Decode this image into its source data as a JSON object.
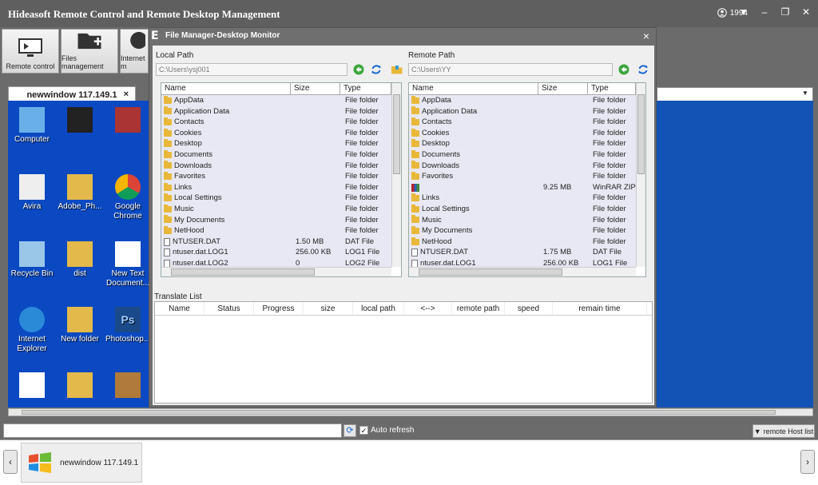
{
  "app": {
    "title": "Hideasoft Remote Control and Remote Desktop Management",
    "user": "1994"
  },
  "toolbar": {
    "remote_control": "Remote control",
    "files_management": "Files management",
    "internet": "Internet m"
  },
  "session_tab": {
    "label": "newwindow 117.149.1",
    "close": "×"
  },
  "desktop_icons": [
    {
      "label": "Computer",
      "icon": "computer-icon"
    },
    {
      "label": "",
      "icon": "qq-icon"
    },
    {
      "label": "",
      "icon": "winrar-icon"
    },
    {
      "label": "Avira",
      "icon": "shortcut-icon"
    },
    {
      "label": "Adobe_Ph...",
      "icon": "folder-icon"
    },
    {
      "label": "Google Chrome",
      "icon": "chrome-icon"
    },
    {
      "label": "Recycle Bin",
      "icon": "recycle-bin-icon"
    },
    {
      "label": "dist",
      "icon": "folder-icon"
    },
    {
      "label": "New Text Document...",
      "icon": "text-file-icon"
    },
    {
      "label": "Internet Explorer",
      "icon": "ie-icon"
    },
    {
      "label": "New folder",
      "icon": "folder-icon"
    },
    {
      "label": "Photoshop...",
      "icon": "photoshop-icon"
    },
    {
      "label": "",
      "icon": "app-icon"
    },
    {
      "label": "",
      "icon": "folder-icon"
    },
    {
      "label": "",
      "icon": "box-icon"
    }
  ],
  "dialog": {
    "title": "File Manager-Desktop Monitor",
    "close": "×",
    "local": {
      "label": "Local Path",
      "path": "C:\\Users\\ysj001",
      "columns": [
        "Name",
        "Size",
        "Type"
      ],
      "rows": [
        {
          "name": "AppData",
          "size": "",
          "type": "File folder",
          "kind": "folder"
        },
        {
          "name": "Application Data",
          "size": "",
          "type": "File folder",
          "kind": "folder"
        },
        {
          "name": "Contacts",
          "size": "",
          "type": "File folder",
          "kind": "folder"
        },
        {
          "name": "Cookies",
          "size": "",
          "type": "File folder",
          "kind": "folder"
        },
        {
          "name": "Desktop",
          "size": "",
          "type": "File folder",
          "kind": "folder"
        },
        {
          "name": "Documents",
          "size": "",
          "type": "File folder",
          "kind": "folder"
        },
        {
          "name": "Downloads",
          "size": "",
          "type": "File folder",
          "kind": "folder"
        },
        {
          "name": "Favorites",
          "size": "",
          "type": "File folder",
          "kind": "folder"
        },
        {
          "name": "Links",
          "size": "",
          "type": "File folder",
          "kind": "folder"
        },
        {
          "name": "Local Settings",
          "size": "",
          "type": "File folder",
          "kind": "folder"
        },
        {
          "name": "Music",
          "size": "",
          "type": "File folder",
          "kind": "folder"
        },
        {
          "name": "My Documents",
          "size": "",
          "type": "File folder",
          "kind": "folder"
        },
        {
          "name": "NetHood",
          "size": "",
          "type": "File folder",
          "kind": "folder"
        },
        {
          "name": "NTUSER.DAT",
          "size": "1.50 MB",
          "type": "DAT File",
          "kind": "file"
        },
        {
          "name": "ntuser.dat.LOG1",
          "size": "256.00 KB",
          "type": "LOG1 File",
          "kind": "file"
        },
        {
          "name": "ntuser.dat.LOG2",
          "size": "0",
          "type": "LOG2 File",
          "kind": "file"
        }
      ]
    },
    "remote": {
      "label": "Remote Path",
      "path": "C:\\Users\\YY",
      "columns": [
        "Name",
        "Size",
        "Type"
      ],
      "rows": [
        {
          "name": "AppData",
          "size": "",
          "type": "File folder",
          "kind": "folder"
        },
        {
          "name": "Application Data",
          "size": "",
          "type": "File folder",
          "kind": "folder"
        },
        {
          "name": "Contacts",
          "size": "",
          "type": "File folder",
          "kind": "folder"
        },
        {
          "name": "Cookies",
          "size": "",
          "type": "File folder",
          "kind": "folder"
        },
        {
          "name": "Desktop",
          "size": "",
          "type": "File folder",
          "kind": "folder"
        },
        {
          "name": "Documents",
          "size": "",
          "type": "File folder",
          "kind": "folder"
        },
        {
          "name": "Downloads",
          "size": "",
          "type": "File folder",
          "kind": "folder"
        },
        {
          "name": "Favorites",
          "size": "",
          "type": "File folder",
          "kind": "folder"
        },
        {
          "name": "",
          "size": "9.25 MB",
          "type": "WinRAR ZIP",
          "kind": "zip"
        },
        {
          "name": "Links",
          "size": "",
          "type": "File folder",
          "kind": "folder"
        },
        {
          "name": "Local Settings",
          "size": "",
          "type": "File folder",
          "kind": "folder"
        },
        {
          "name": "Music",
          "size": "",
          "type": "File folder",
          "kind": "folder"
        },
        {
          "name": "My Documents",
          "size": "",
          "type": "File folder",
          "kind": "folder"
        },
        {
          "name": "NetHood",
          "size": "",
          "type": "File folder",
          "kind": "folder"
        },
        {
          "name": "NTUSER.DAT",
          "size": "1.75 MB",
          "type": "DAT File",
          "kind": "file"
        },
        {
          "name": "ntuser.dat.LOG1",
          "size": "256.00 KB",
          "type": "LOG1 File",
          "kind": "file"
        }
      ]
    },
    "translate": {
      "label": "Translate List",
      "columns": [
        "Name",
        "Status",
        "Progress",
        "size",
        "local path",
        "<-->",
        "remote path",
        "speed",
        "remain time"
      ]
    }
  },
  "bottom": {
    "auto_refresh": "Auto refresh",
    "auto_refresh_checked": true,
    "host_list": "remote Host list"
  },
  "host_strip": {
    "item": "newwindow 117.149.1"
  }
}
